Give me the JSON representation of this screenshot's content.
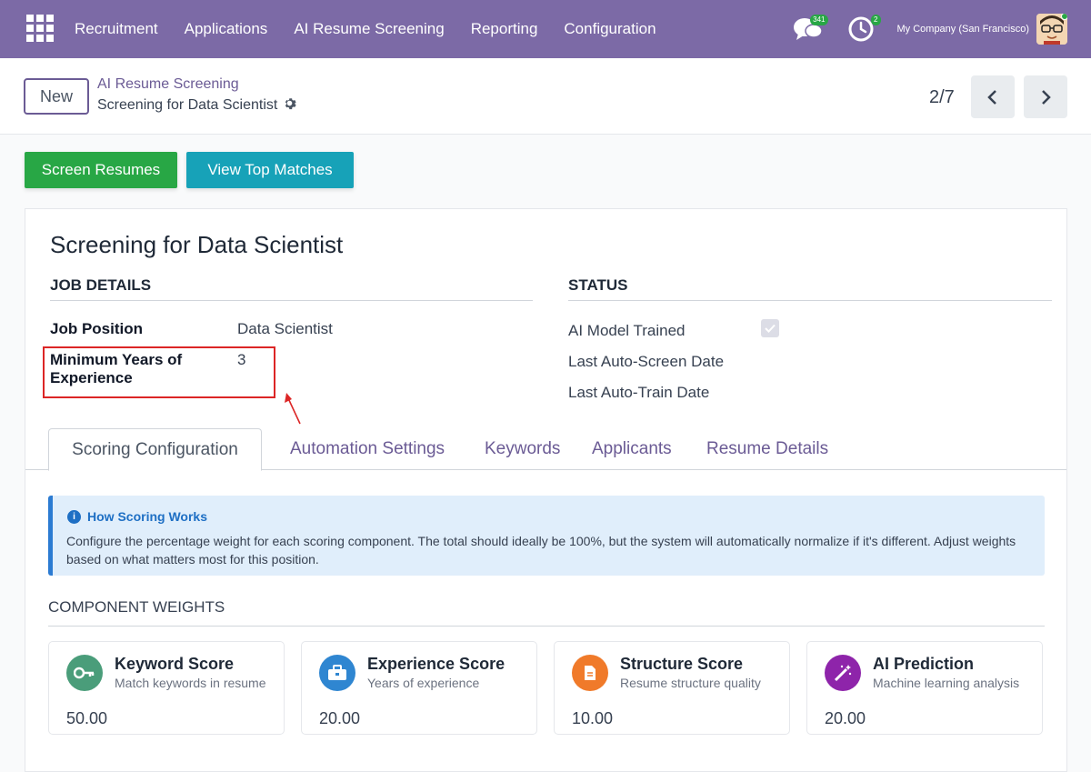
{
  "topbar": {
    "menu": [
      "Recruitment",
      "Applications",
      "AI Resume Screening",
      "Reporting",
      "Configuration"
    ],
    "chat_badge": "341",
    "activity_badge": "2",
    "company": "My Company (San Francisco)"
  },
  "control": {
    "new_label": "New",
    "breadcrumb_parent": "AI Resume Screening",
    "breadcrumb_current": "Screening for Data Scientist",
    "pager": "2/7"
  },
  "actions": {
    "screen_resumes": "Screen Resumes",
    "view_top_matches": "View Top Matches"
  },
  "record": {
    "title": "Screening for Data Scientist",
    "job_details_heading": "JOB DETAILS",
    "status_heading": "STATUS",
    "job_position_label": "Job Position",
    "job_position_value": "Data Scientist",
    "min_exp_label": "Minimum Years of Experience",
    "min_exp_value": "3",
    "ai_model_trained_label": "AI Model Trained",
    "last_auto_screen_label": "Last Auto-Screen Date",
    "last_auto_train_label": "Last Auto-Train Date"
  },
  "tabs": [
    "Scoring Configuration",
    "Automation Settings",
    "Keywords",
    "Applicants",
    "Resume Details"
  ],
  "alert": {
    "title": "How Scoring Works",
    "body": "Configure the percentage weight for each scoring component. The total should ideally be 100%, but the system will automatically normalize if it's different. Adjust weights based on what matters most for this position."
  },
  "weights_heading": "COMPONENT WEIGHTS",
  "cards": [
    {
      "title": "Keyword Score",
      "subtitle": "Match keywords in resume",
      "value": "50.00",
      "color": "#4a9d7a",
      "icon": "key-icon"
    },
    {
      "title": "Experience Score",
      "subtitle": "Years of experience",
      "value": "20.00",
      "color": "#2f86d1",
      "icon": "briefcase-icon"
    },
    {
      "title": "Structure Score",
      "subtitle": "Resume structure quality",
      "value": "10.00",
      "color": "#f07a2a",
      "icon": "document-icon"
    },
    {
      "title": "AI Prediction",
      "subtitle": "Machine learning analysis",
      "value": "20.00",
      "color": "#8e24aa",
      "icon": "magic-wand-icon"
    }
  ]
}
